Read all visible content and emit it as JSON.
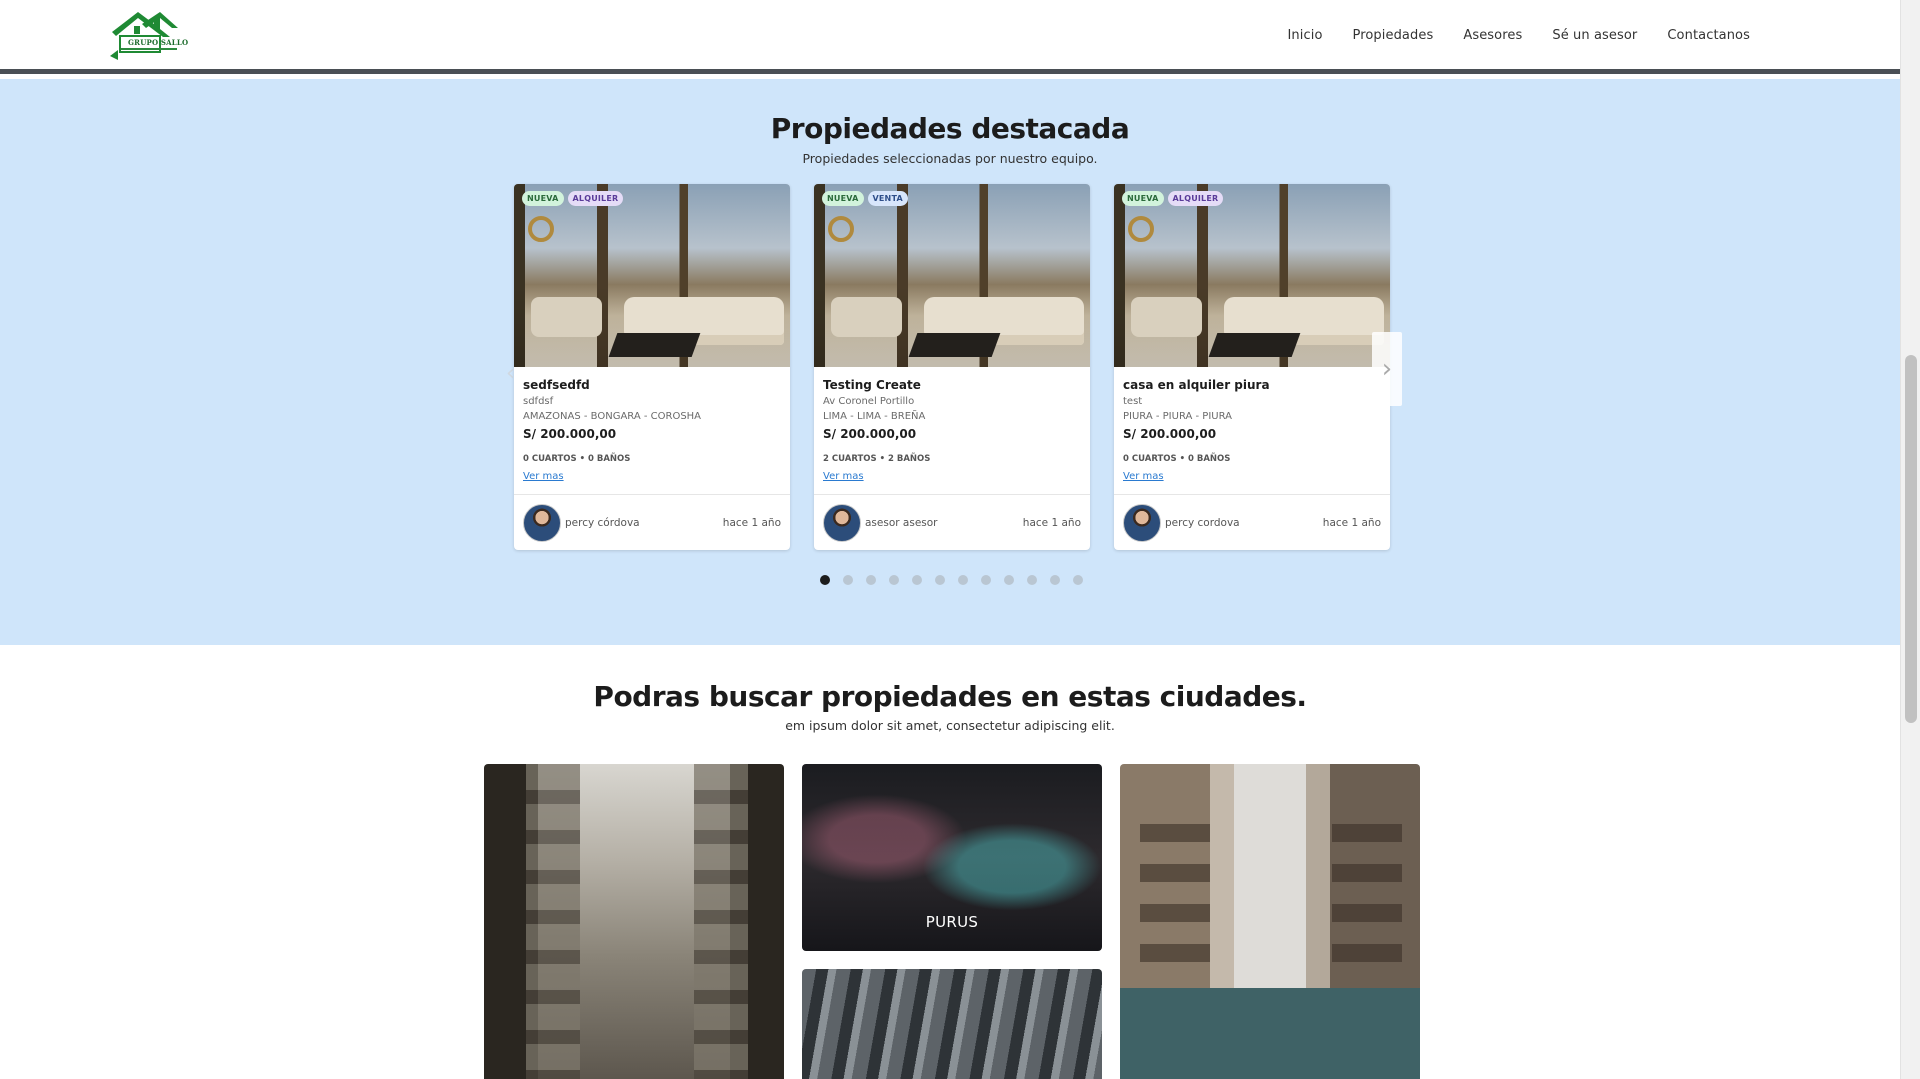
{
  "brand": {
    "logo_text": "GRUPO SALLO",
    "color": "#1c6b2c"
  },
  "nav": {
    "items": [
      {
        "label": "Inicio"
      },
      {
        "label": "Propiedades"
      },
      {
        "label": "Asesores"
      },
      {
        "label": "Sé un asesor"
      },
      {
        "label": "Contactanos"
      }
    ]
  },
  "featured": {
    "title": "Propiedades destacada",
    "subtitle": "Propiedades seleccionadas por nuestro equipo.",
    "background": "#cfe5fa",
    "cards": [
      {
        "badges": [
          "NUEVA",
          "ALQUILER"
        ],
        "title": "sedfsedfd",
        "address": "sdfdsf",
        "location": "AMAZONAS - BONGARA - COROSHA",
        "price": "S/ 200.000,00",
        "meta": "0 CUARTOS • 0 BAÑOS",
        "link": "Ver mas",
        "agent": "percy córdova",
        "ago": "hace 1 año"
      },
      {
        "badges": [
          "NUEVA",
          "VENTA"
        ],
        "title": "Testing Create",
        "address": "Av Coronel Portillo",
        "location": "LIMA - LIMA - BREÑA",
        "price": "S/ 200.000,00",
        "meta": "2 CUARTOS • 2 BAÑOS",
        "link": "Ver mas",
        "agent": "asesor asesor",
        "ago": "hace 1 año"
      },
      {
        "badges": [
          "NUEVA",
          "ALQUILER"
        ],
        "title": "casa en alquiler piura",
        "address": "test",
        "location": "PIURA - PIURA - PIURA",
        "price": "S/ 200.000,00",
        "meta": "0 CUARTOS • 0 BAÑOS",
        "link": "Ver mas",
        "agent": "percy cordova",
        "ago": "hace 1 año"
      }
    ],
    "pagination": {
      "total": 12,
      "active": 1
    }
  },
  "cities": {
    "title": "Podras buscar propiedades en estas ciudades.",
    "subtitle": "em ipsum dolor sit amet, consectetur adipiscing elit.",
    "tiles": [
      {
        "label": ""
      },
      {
        "label": "PURUS"
      },
      {
        "label": ""
      },
      {
        "label": ""
      }
    ]
  },
  "icons": {
    "next": "chevron-right-icon",
    "prev": "chevron-left-icon"
  }
}
